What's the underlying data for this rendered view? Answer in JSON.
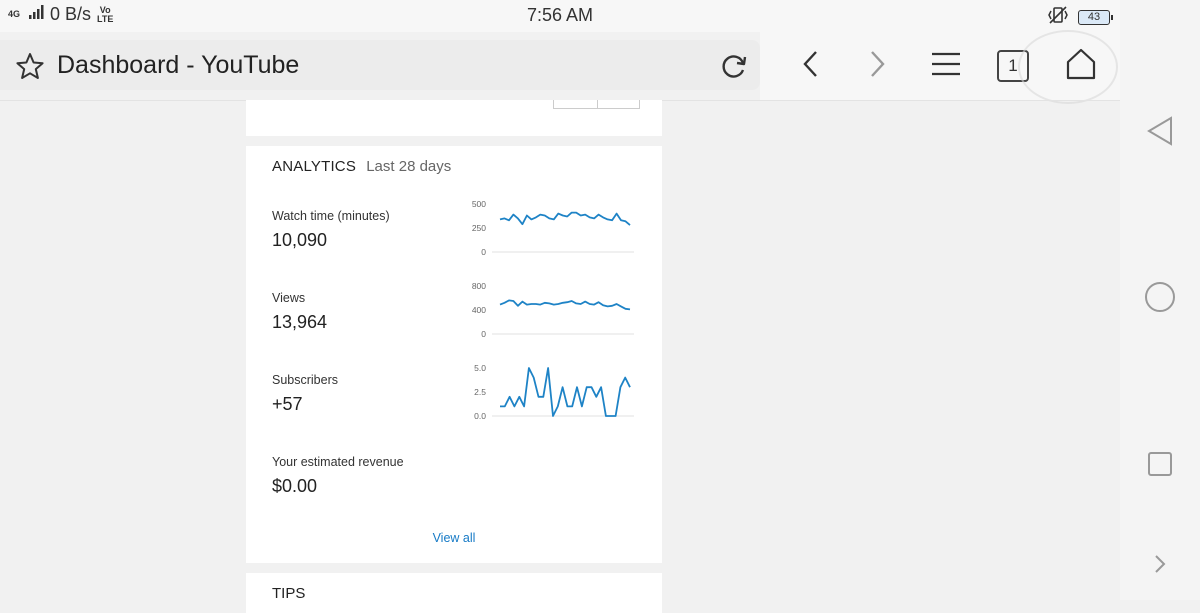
{
  "status_bar": {
    "network": "4G",
    "speed": "0 B/s",
    "volte_top": "Vo",
    "volte_bottom": "LTE",
    "time": "7:56 AM",
    "battery": "43"
  },
  "browser": {
    "page_title": "Dashboard - YouTube",
    "tab_count": "1"
  },
  "analytics": {
    "title": "ANALYTICS",
    "period": "Last 28 days",
    "metrics": [
      {
        "label": "Watch time (minutes)",
        "value": "10,090",
        "chart": {
          "ticks": [
            "500",
            "250",
            "0"
          ],
          "ymax": 500,
          "values": [
            340,
            350,
            330,
            390,
            350,
            290,
            380,
            340,
            360,
            390,
            380,
            350,
            340,
            400,
            380,
            370,
            410,
            410,
            380,
            390,
            360,
            350,
            390,
            360,
            340,
            330,
            400,
            330,
            320,
            280
          ]
        }
      },
      {
        "label": "Views",
        "value": "13,964",
        "chart": {
          "ticks": [
            "800",
            "400",
            "0"
          ],
          "ymax": 800,
          "values": [
            490,
            520,
            560,
            550,
            470,
            540,
            490,
            500,
            500,
            490,
            520,
            510,
            490,
            500,
            520,
            530,
            550,
            510,
            500,
            540,
            500,
            490,
            530,
            480,
            460,
            470,
            500,
            460,
            420,
            410
          ]
        }
      },
      {
        "label": "Subscribers",
        "value": "+57",
        "chart": {
          "ticks": [
            "5.0",
            "2.5",
            "0.0"
          ],
          "ymax": 5,
          "values": [
            1,
            1,
            2,
            1,
            2,
            1,
            5,
            4,
            2,
            2,
            5,
            0,
            1,
            3,
            1,
            1,
            3,
            1,
            3,
            3,
            2,
            3,
            0,
            0,
            0,
            3,
            4,
            3
          ]
        }
      },
      {
        "label": "Your estimated revenue",
        "value": "$0.00"
      }
    ],
    "view_all": "View all"
  },
  "tips": {
    "title": "TIPS"
  },
  "colors": {
    "chart_line": "#1e83c6",
    "link": "#167ac6"
  }
}
